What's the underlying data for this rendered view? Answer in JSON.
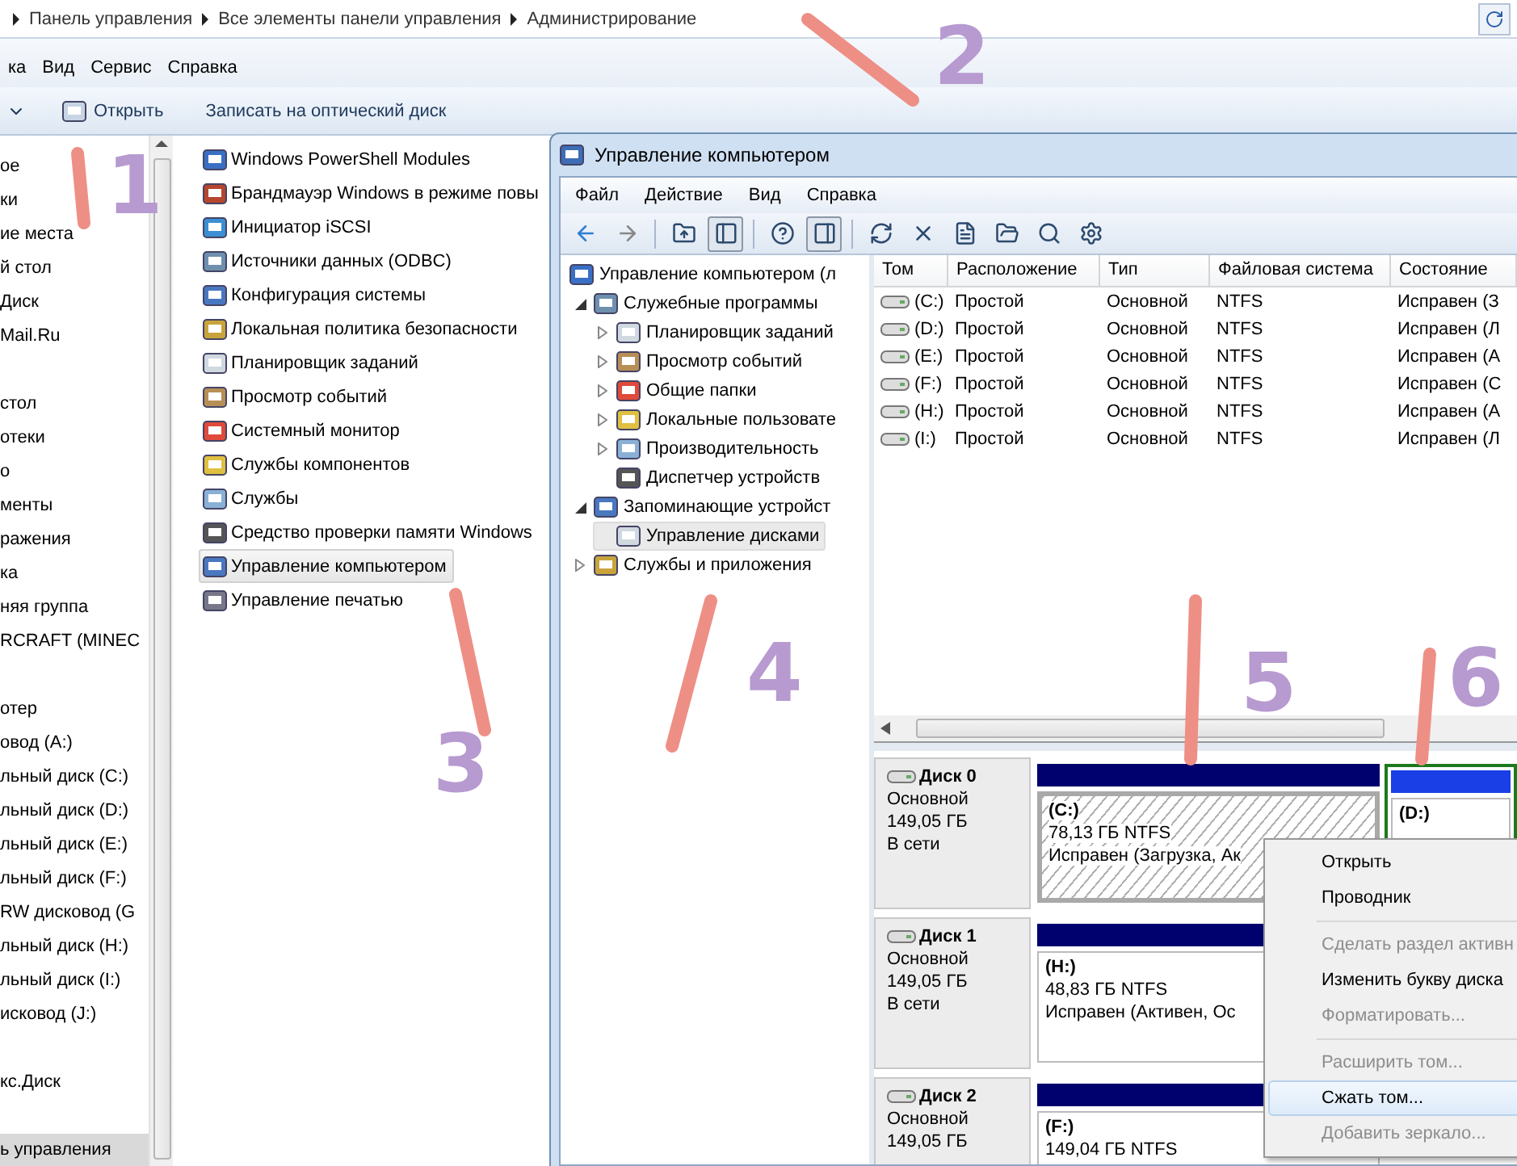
{
  "address_bar": {
    "crumbs": [
      "Панель управления",
      "Все элементы панели управления",
      "Администрирование"
    ]
  },
  "menu_bar": [
    "ка",
    "Вид",
    "Сервис",
    "Справка"
  ],
  "toolbar": {
    "buttons": [
      "Открыть",
      "Записать на оптический диск"
    ]
  },
  "nav_pane": {
    "groups": [
      [
        {
          "label": "ое",
          "selected": false
        },
        {
          "label": "ки",
          "selected": false
        },
        {
          "label": "ие места",
          "selected": false
        },
        {
          "label": "й стол",
          "selected": false
        },
        {
          "label": "Диск",
          "selected": false
        },
        {
          "label": "Mail.Ru",
          "selected": false
        }
      ],
      [
        {
          "label": "стол",
          "selected": false
        },
        {
          "label": "отеки",
          "selected": false
        },
        {
          "label": "о",
          "selected": false
        },
        {
          "label": "менты",
          "selected": false
        },
        {
          "label": "ражения",
          "selected": false
        },
        {
          "label": "ка",
          "selected": false
        },
        {
          "label": "няя группа",
          "selected": false
        },
        {
          "label": "RCRAFT (MINEC",
          "selected": false
        }
      ],
      [
        {
          "label": "отер",
          "selected": false
        },
        {
          "label": "овод (A:)",
          "selected": false
        },
        {
          "label": "льный диск (C:)",
          "selected": false
        },
        {
          "label": "льный диск (D:)",
          "selected": false
        },
        {
          "label": "льный диск (E:)",
          "selected": false
        },
        {
          "label": "льный диск (F:)",
          "selected": false
        },
        {
          "label": "RW дисковод (G",
          "selected": false
        },
        {
          "label": "льный диск (H:)",
          "selected": false
        },
        {
          "label": "льный диск (I:)",
          "selected": false
        },
        {
          "label": "исковод (J:)",
          "selected": false
        }
      ],
      [
        {
          "label": "кс.Диск",
          "selected": false
        }
      ],
      [
        {
          "label": "ь управления",
          "selected": true
        }
      ]
    ]
  },
  "file_list": [
    {
      "name": "Windows PowerShell Modules",
      "selected": false
    },
    {
      "name": "Брандмауэр Windows в режиме повы",
      "selected": false
    },
    {
      "name": "Инициатор iSCSI",
      "selected": false
    },
    {
      "name": "Источники данных (ODBC)",
      "selected": false
    },
    {
      "name": "Конфигурация системы",
      "selected": false
    },
    {
      "name": "Локальная политика безопасности",
      "selected": false
    },
    {
      "name": "Планировщик заданий",
      "selected": false
    },
    {
      "name": "Просмотр событий",
      "selected": false
    },
    {
      "name": "Системный монитор",
      "selected": false
    },
    {
      "name": "Службы компонентов",
      "selected": false
    },
    {
      "name": "Службы",
      "selected": false
    },
    {
      "name": "Средство проверки памяти Windows",
      "selected": false
    },
    {
      "name": "Управление компьютером",
      "selected": true
    },
    {
      "name": "Управление печатью",
      "selected": false
    }
  ],
  "window": {
    "title": "Управление компьютером",
    "menu": [
      "Файл",
      "Действие",
      "Вид",
      "Справка"
    ],
    "tree": [
      {
        "label": "Управление компьютером (л",
        "selected": false,
        "children": [
          {
            "label": "Служебные программы",
            "selected": false,
            "expanded": true,
            "children": [
              {
                "label": "Планировщик заданий",
                "selected": false,
                "expanded": false
              },
              {
                "label": "Просмотр событий",
                "selected": false,
                "expanded": false
              },
              {
                "label": "Общие папки",
                "selected": false,
                "expanded": false
              },
              {
                "label": "Локальные пользовате",
                "selected": false,
                "expanded": false
              },
              {
                "label": "Производительность",
                "selected": false,
                "expanded": false
              },
              {
                "label": "Диспетчер устройств",
                "selected": false
              }
            ]
          },
          {
            "label": "Запоминающие устройст",
            "selected": false,
            "expanded": true,
            "children": [
              {
                "label": "Управление дисками",
                "selected": true
              }
            ]
          },
          {
            "label": "Службы и приложения",
            "selected": false,
            "expanded": false
          }
        ]
      }
    ],
    "volumes": {
      "columns": [
        "Том",
        "Расположение",
        "Тип",
        "Файловая система",
        "Состояние"
      ],
      "rows": [
        [
          "(C:)",
          "Простой",
          "Основной",
          "NTFS",
          "Исправен (З"
        ],
        [
          "(D:)",
          "Простой",
          "Основной",
          "NTFS",
          "Исправен (Л"
        ],
        [
          "(E:)",
          "Простой",
          "Основной",
          "NTFS",
          "Исправен (А"
        ],
        [
          "(F:)",
          "Простой",
          "Основной",
          "NTFS",
          "Исправен (С"
        ],
        [
          "(H:)",
          "Простой",
          "Основной",
          "NTFS",
          "Исправен (А"
        ],
        [
          "(I:)",
          "Простой",
          "Основной",
          "NTFS",
          "Исправен (Л"
        ]
      ]
    },
    "disks": [
      {
        "name": "Диск 0",
        "type": "Основной",
        "size": "149,05 ГБ",
        "status": "В сети",
        "partitions": [
          {
            "kind": "primary",
            "label": "(C:)",
            "size": "78,13 ГБ NTFS",
            "status": "Исправен (Загрузка, Ак",
            "selected": true
          },
          {
            "kind": "logical",
            "label": "(D:)",
            "selected": false
          }
        ]
      },
      {
        "name": "Диск 1",
        "type": "Основной",
        "size": "149,05 ГБ",
        "status": "В сети",
        "partitions": [
          {
            "kind": "primary",
            "label": "(H:)",
            "size": "48,83 ГБ NTFS",
            "status": "Исправен (Активен, Ос",
            "selected": false
          }
        ]
      },
      {
        "name": "Диск 2",
        "type": "Основной",
        "size": "149,05 ГБ",
        "partitions": [
          {
            "kind": "primary",
            "label": "(F:)",
            "size": "149,04 ГБ NTFS",
            "selected": false
          }
        ]
      }
    ],
    "context_menu": [
      {
        "kind": "item",
        "label": "Открыть",
        "disabled": false,
        "selected": false
      },
      {
        "kind": "item",
        "label": "Проводник",
        "disabled": false,
        "selected": false
      },
      {
        "kind": "separator"
      },
      {
        "kind": "item",
        "label": "Сделать раздел активн",
        "disabled": true,
        "selected": false
      },
      {
        "kind": "item",
        "label": "Изменить букву диска",
        "disabled": false,
        "selected": false
      },
      {
        "kind": "item",
        "label": "Форматировать...",
        "disabled": true,
        "selected": false
      },
      {
        "kind": "separator"
      },
      {
        "kind": "item",
        "label": "Расширить том...",
        "disabled": true,
        "selected": false
      },
      {
        "kind": "item",
        "label": "Сжать том...",
        "disabled": false,
        "selected": true
      },
      {
        "kind": "item",
        "label": "Добавить зеркало...",
        "disabled": true,
        "selected": false
      }
    ]
  },
  "annotations": [
    {
      "label": "1"
    },
    {
      "label": "2"
    },
    {
      "label": "3"
    },
    {
      "label": "4"
    },
    {
      "label": "5"
    },
    {
      "label": "6"
    }
  ]
}
